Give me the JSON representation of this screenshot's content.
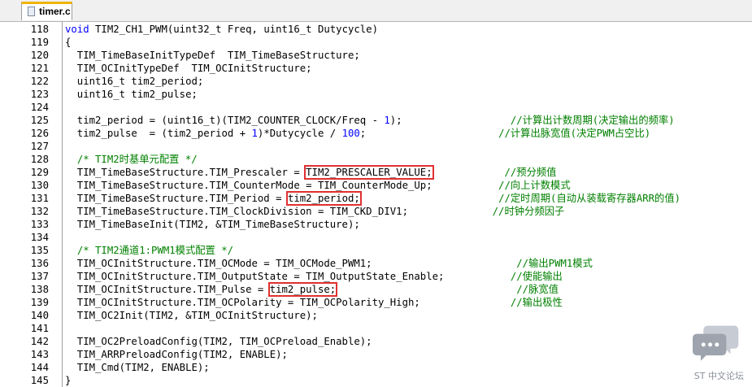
{
  "tab": {
    "label": "timer.c"
  },
  "lines": [
    {
      "n": "118",
      "segs": [
        {
          "t": "void",
          "c": "kw"
        },
        {
          "t": " TIM2_CH1_PWM(uint32_t Freq, uint16_t Dutycycle)"
        }
      ]
    },
    {
      "n": "119",
      "segs": [
        {
          "t": "{"
        }
      ]
    },
    {
      "n": "120",
      "segs": [
        {
          "t": "  TIM_TimeBaseInitTypeDef  TIM_TimeBaseStructure;"
        }
      ]
    },
    {
      "n": "121",
      "segs": [
        {
          "t": "  TIM_OCInitTypeDef  TIM_OCInitStructure;"
        }
      ]
    },
    {
      "n": "122",
      "segs": [
        {
          "t": "  uint16_t tim2_period;"
        }
      ]
    },
    {
      "n": "123",
      "segs": [
        {
          "t": "  uint16_t tim2_pulse;"
        }
      ]
    },
    {
      "n": "124",
      "segs": []
    },
    {
      "n": "125",
      "segs": [
        {
          "t": "  tim2_period = (uint16_t)(TIM2_COUNTER_CLOCK/Freq - "
        },
        {
          "t": "1",
          "c": "num"
        },
        {
          "t": ");                  "
        },
        {
          "t": "//计算出计数周期(决定输出的频率)",
          "c": "cmt"
        }
      ]
    },
    {
      "n": "126",
      "segs": [
        {
          "t": "  tim2_pulse  = (tim2_period + "
        },
        {
          "t": "1",
          "c": "num"
        },
        {
          "t": ")*Dutycycle / "
        },
        {
          "t": "100",
          "c": "num"
        },
        {
          "t": ";                      "
        },
        {
          "t": "//计算出脉宽值(决定PWM占空比)",
          "c": "cmt"
        }
      ]
    },
    {
      "n": "127",
      "segs": []
    },
    {
      "n": "128",
      "segs": [
        {
          "t": "  "
        },
        {
          "t": "/* TIM2时基单元配置 */",
          "c": "cmt"
        }
      ]
    },
    {
      "n": "129",
      "segs": [
        {
          "t": "  TIM_TimeBaseStructure.TIM_Prescaler = "
        },
        {
          "t": "TIM2_PRESCALER_VALUE;",
          "h": true
        },
        {
          "t": "            "
        },
        {
          "t": "//预分频值",
          "c": "cmt"
        }
      ]
    },
    {
      "n": "130",
      "segs": [
        {
          "t": "  TIM_TimeBaseStructure.TIM_CounterMode = TIM_CounterMode_Up;           "
        },
        {
          "t": "//向上计数模式",
          "c": "cmt"
        }
      ]
    },
    {
      "n": "131",
      "segs": [
        {
          "t": "  TIM_TimeBaseStructure.TIM_Period = "
        },
        {
          "t": "tim2_period;",
          "h": true
        },
        {
          "t": "                       "
        },
        {
          "t": "//定时周期(自动从装载寄存器ARR的值)",
          "c": "cmt"
        }
      ]
    },
    {
      "n": "132",
      "segs": [
        {
          "t": "  TIM_TimeBaseStructure.TIM_ClockDivision = TIM_CKD_DIV1;              "
        },
        {
          "t": "//时钟分频因子",
          "c": "cmt"
        }
      ]
    },
    {
      "n": "133",
      "segs": [
        {
          "t": "  TIM_TimeBaseInit(TIM2, &TIM_TimeBaseStructure);"
        }
      ]
    },
    {
      "n": "134",
      "segs": []
    },
    {
      "n": "135",
      "segs": [
        {
          "t": "  "
        },
        {
          "t": "/* TIM2通道1:PWM1模式配置 */",
          "c": "cmt"
        }
      ]
    },
    {
      "n": "136",
      "segs": [
        {
          "t": "  TIM_OCInitStructure.TIM_OCMode = TIM_OCMode_PWM1;                        "
        },
        {
          "t": "//输出PWM1模式",
          "c": "cmt"
        }
      ]
    },
    {
      "n": "137",
      "segs": [
        {
          "t": "  TIM_OCInitStructure.TIM_OutputState = TIM_OutputState_Enable;           "
        },
        {
          "t": "//使能输出",
          "c": "cmt"
        }
      ]
    },
    {
      "n": "138",
      "segs": [
        {
          "t": "  TIM_OCInitStructure.TIM_Pulse = "
        },
        {
          "t": "tim2_pulse;",
          "h": true
        },
        {
          "t": "                              "
        },
        {
          "t": "//脉宽值",
          "c": "cmt"
        }
      ]
    },
    {
      "n": "139",
      "segs": [
        {
          "t": "  TIM_OCInitStructure.TIM_OCPolarity = TIM_OCPolarity_High;               "
        },
        {
          "t": "//输出极性",
          "c": "cmt"
        }
      ]
    },
    {
      "n": "140",
      "segs": [
        {
          "t": "  TIM_OC2Init(TIM2, &TIM_OCInitStructure);"
        }
      ]
    },
    {
      "n": "141",
      "segs": []
    },
    {
      "n": "142",
      "segs": [
        {
          "t": "  TIM_OC2PreloadConfig(TIM2, TIM_OCPreload_Enable);"
        }
      ]
    },
    {
      "n": "143",
      "segs": [
        {
          "t": "  TIM_ARRPreloadConfig(TIM2, ENABLE);"
        }
      ]
    },
    {
      "n": "144",
      "segs": [
        {
          "t": "  TIM_Cmd(TIM2, ENABLE);"
        }
      ]
    },
    {
      "n": "145",
      "segs": [
        {
          "t": "}"
        }
      ]
    }
  ],
  "watermark": {
    "text": "ST 中文论坛",
    "icon": "chat-bubbles-icon"
  },
  "colors": {
    "keyword": "#0000ff",
    "comment": "#008000",
    "highlight_box": "#e03030",
    "tab_accent": "#f0b400"
  }
}
